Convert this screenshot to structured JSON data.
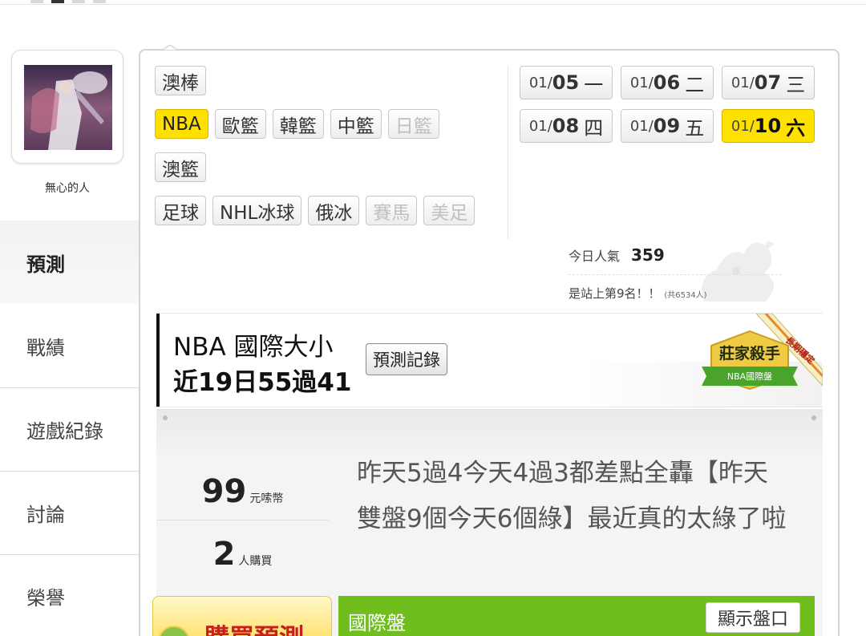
{
  "user": {
    "name": "無心的人"
  },
  "menu": [
    {
      "label": "預測",
      "active": true
    },
    {
      "label": "戰績"
    },
    {
      "label": "遊戲紀錄"
    },
    {
      "label": "討論"
    },
    {
      "label": "榮譽"
    }
  ],
  "sports": {
    "row1": [
      {
        "label": "澳棒"
      }
    ],
    "row2": [
      {
        "label": "NBA",
        "state": "active"
      },
      {
        "label": "歐籃"
      },
      {
        "label": "韓籃"
      },
      {
        "label": "中籃"
      },
      {
        "label": "日籃",
        "state": "disabled"
      }
    ],
    "row3": [
      {
        "label": "澳籃"
      }
    ],
    "row4": [
      {
        "label": "足球"
      },
      {
        "label": "NHL冰球"
      },
      {
        "label": "俄冰"
      },
      {
        "label": "賽馬",
        "state": "disabled"
      },
      {
        "label": "美足",
        "state": "disabled"
      }
    ]
  },
  "dates": [
    {
      "month": "01/",
      "day": "05",
      "weekday": "一"
    },
    {
      "month": "01/",
      "day": "06",
      "weekday": "二"
    },
    {
      "month": "01/",
      "day": "07",
      "weekday": "三"
    },
    {
      "month": "01/",
      "day": "08",
      "weekday": "四"
    },
    {
      "month": "01/",
      "day": "09",
      "weekday": "五"
    },
    {
      "month": "01/",
      "day": "10",
      "weekday": "六",
      "active": true
    }
  ],
  "popularity": {
    "label": "今日人氣",
    "value": "359",
    "rank_text": "是站上第9名！！",
    "rank_total": "(共6534人)"
  },
  "prediction": {
    "title": "NBA 國際大小",
    "record_summary": "近19日55過41",
    "record_button": "預測記錄",
    "badge_title": "莊家殺手",
    "badge_sub": "NBA國際盤",
    "badge_ribbon": "長期穩定"
  },
  "offer": {
    "price": "99",
    "price_unit": "元嗦幣",
    "buyers": "2",
    "buyers_unit": "人購買",
    "description": "昨天5過4今天4過3都差點全轟【昨天雙盤9個今天6個綠】最近真的太綠了啦"
  },
  "buy_button": {
    "label": "購買預測"
  },
  "market_bar": {
    "label": "國際盤",
    "show_button": "顯示盤口"
  },
  "colors": {
    "accent_yellow": "#ffe100",
    "market_green": "#6fbe1e",
    "buy_red": "#c81e1e"
  }
}
